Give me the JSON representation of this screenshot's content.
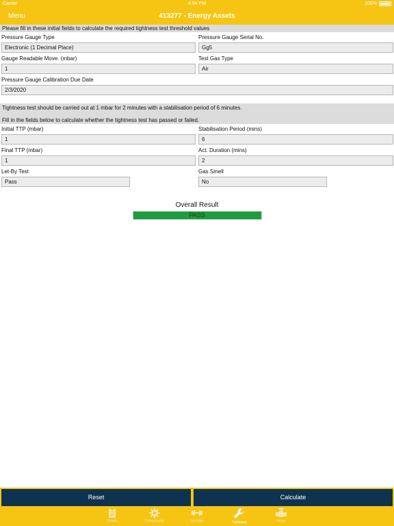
{
  "status": {
    "carrier": "Carrier",
    "time": "4:54 PM",
    "battery": "100%"
  },
  "nav": {
    "menu": "Menu",
    "title": "413277 - Energy Assets"
  },
  "initial_banner": "Please fill in these initial fields to calculate the required tightness test threshold values",
  "fields": {
    "pressure_gauge_type": {
      "label": "Pressure Gauge Type",
      "value": "Electronic (1 Decimal Place)"
    },
    "pressure_gauge_serial": {
      "label": "Pressure Gauge Serial No.",
      "value": "Gg5"
    },
    "gauge_readable_move": {
      "label": "Gauge Readable Move. (mbar)",
      "value": "1"
    },
    "test_gas_type": {
      "label": "Test Gas Type",
      "value": "Air"
    },
    "calibration_due_date": {
      "label": "Pressure Gauge Calibration Due Date",
      "value": "2/3/2020"
    },
    "initial_ttp": {
      "label": "Initial TTP (mbar)",
      "value": "1"
    },
    "stabilisation_period": {
      "label": "Stabilisation Period (mins)",
      "value": "6"
    },
    "final_ttp": {
      "label": "Final TTP (mbar)",
      "value": "1"
    },
    "act_duration": {
      "label": "Act. Duration (mins)",
      "value": "2"
    },
    "let_by_test": {
      "label": "Let-By Test",
      "value": "Pass"
    },
    "gas_smell": {
      "label": "Gas Smell",
      "value": "No"
    }
  },
  "test_banner": {
    "line1": "Tightness test should be carried out at 1 mbar for 2 minutes with a stabilisation period of 6 minutes.",
    "line2": "Fill in the fields below to calculate whether the tightness test has passed or failed."
  },
  "result": {
    "title": "Overall Result",
    "value": "PASS",
    "color": "#1b9e3e"
  },
  "buttons": {
    "reset": "Reset",
    "calculate": "Calculate"
  },
  "tabs": [
    {
      "label": "Details",
      "icon": "clipboard-icon"
    },
    {
      "label": "Components",
      "icon": "gear-icon"
    },
    {
      "label": "Strength",
      "icon": "dumbbell-icon"
    },
    {
      "label": "Tightness",
      "icon": "wrench-icon",
      "active": true
    },
    {
      "label": "Purge",
      "icon": "valve-icon"
    }
  ],
  "colors": {
    "brand": "#f6c514",
    "button": "#0e3351",
    "pass": "#1b9e3e"
  }
}
